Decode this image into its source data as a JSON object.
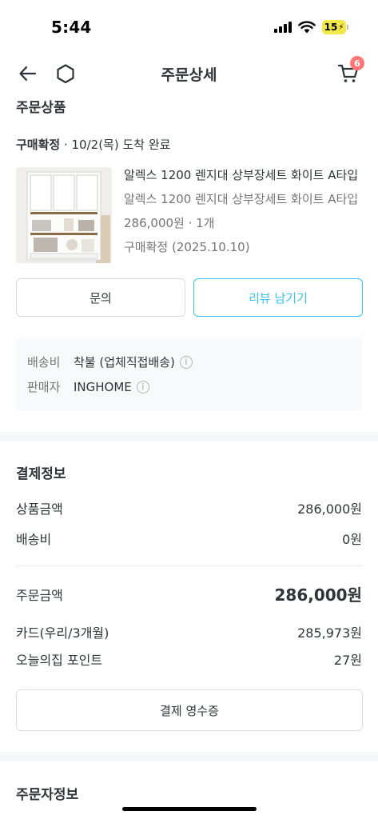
{
  "status_bar": {
    "time": "5:44",
    "battery": "15"
  },
  "nav": {
    "title": "주문상세",
    "cart_count": "6"
  },
  "ordered_products": {
    "section_title": "주문상품",
    "status_bold": "구매확정",
    "status_rest": " · 10/2(목) 도착 완료",
    "product": {
      "name": "알렉스 1200 렌지대 상부장세트 화이트 A타입",
      "option": "알렉스 1200 렌지대 상부장세트 화이트 A타입",
      "price_qty": "286,000원 · 1개",
      "confirm_date": "구매확정 (2025.10.10)"
    },
    "buttons": {
      "inquiry": "문의",
      "review": "리뷰 남기기"
    },
    "shipping_info": {
      "fee_label": "배송비",
      "fee_value": "착불 (업체직접배송)",
      "seller_label": "판매자",
      "seller_value": "INGHOME"
    }
  },
  "payment": {
    "section_title": "결제정보",
    "rows": [
      {
        "label": "상품금액",
        "value": "286,000원"
      },
      {
        "label": "배송비",
        "value": "0원"
      }
    ],
    "total": {
      "label": "주문금액",
      "value": "286,000원"
    },
    "methods": [
      {
        "label": "카드(우리/3개월)",
        "value": "285,973원"
      },
      {
        "label": "오늘의집 포인트",
        "value": "27원"
      }
    ],
    "receipt_button": "결제 영수증"
  },
  "orderer": {
    "section_title": "주문자정보"
  },
  "colors": {
    "accent": "#35c5f0",
    "badge": "#ff7777",
    "text": "#2f3438",
    "sub_text": "#757575"
  }
}
